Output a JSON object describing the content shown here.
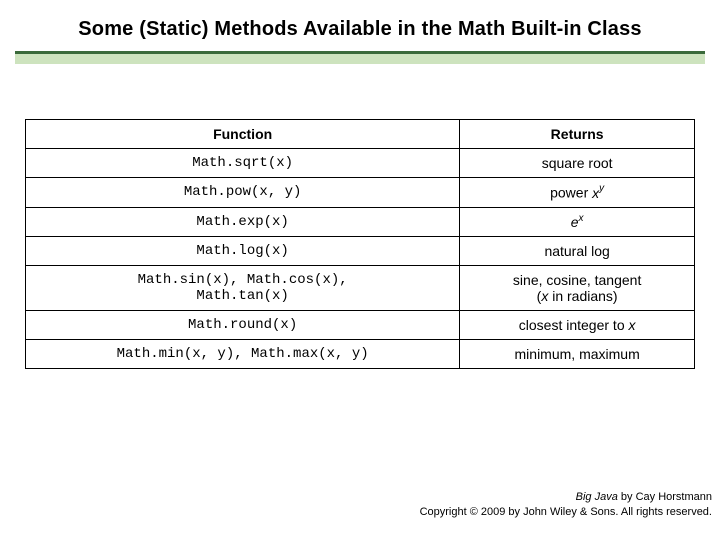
{
  "title": "Some (Static) Methods Available in the Math Built-in Class",
  "headers": {
    "fn": "Function",
    "ret": "Returns"
  },
  "rows": [
    {
      "fn": "Math.sqrt(x)",
      "ret_html": "square root"
    },
    {
      "fn": "Math.pow(x, y)",
      "ret_html": "power <span class='ital'>x<sup>y</sup></span>"
    },
    {
      "fn": "Math.exp(x)",
      "ret_html": "<span class='ital'>e<sup>x</sup></span>"
    },
    {
      "fn": "Math.log(x)",
      "ret_html": "natural log"
    },
    {
      "fn": "Math.sin(x), Math.cos(x),\nMath.tan(x)",
      "ret_html": "sine, cosine, tangent<br>(<span class='ital'>x</span> in radians)"
    },
    {
      "fn": "Math.round(x)",
      "ret_html": "closest integer to <span class='ital'>x</span>"
    },
    {
      "fn": "Math.min(x, y), Math.max(x, y)",
      "ret_html": "minimum, maximum"
    }
  ],
  "footer": {
    "line1_html": "<span class='ital'>Big Java</span> by Cay Horstmann",
    "line2": "Copyright © 2009 by John Wiley & Sons.  All rights reserved."
  },
  "chart_data": {
    "type": "table",
    "title": "Some (Static) Methods Available in the Math Built-in Class",
    "columns": [
      "Function",
      "Returns"
    ],
    "rows": [
      [
        "Math.sqrt(x)",
        "square root"
      ],
      [
        "Math.pow(x, y)",
        "power x^y"
      ],
      [
        "Math.exp(x)",
        "e^x"
      ],
      [
        "Math.log(x)",
        "natural log"
      ],
      [
        "Math.sin(x), Math.cos(x), Math.tan(x)",
        "sine, cosine, tangent (x in radians)"
      ],
      [
        "Math.round(x)",
        "closest integer to x"
      ],
      [
        "Math.min(x, y), Math.max(x, y)",
        "minimum, maximum"
      ]
    ]
  }
}
